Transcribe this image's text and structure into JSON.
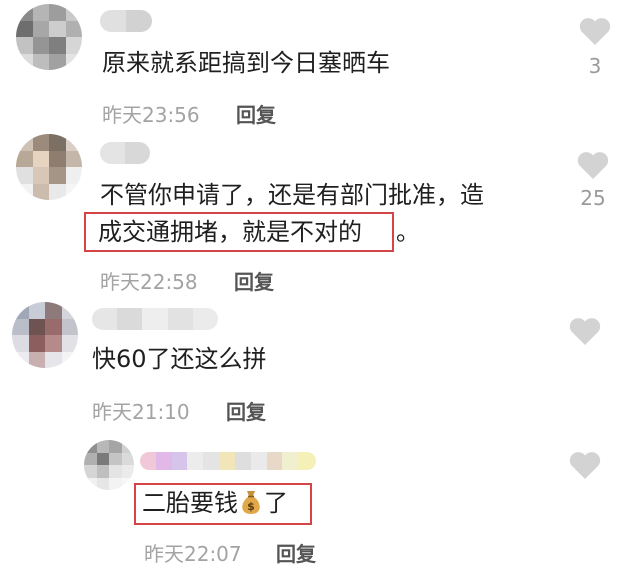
{
  "comments": [
    {
      "text": "原来就系距搞到今日塞晒车",
      "time": "昨天23:56",
      "reply": "回复",
      "likes": "3"
    },
    {
      "text_line1": "不管你申请了，还是有部门批准，造",
      "text_line2_highlight": "成交通拥堵，就是不对的",
      "text_line2_tail": "。",
      "time": "昨天22:58",
      "reply": "回复",
      "likes": "25"
    },
    {
      "text": "快60了还这么拼",
      "time": "昨天21:10",
      "reply": "回复"
    },
    {
      "text_before": "二胎要钱",
      "text_after": "了",
      "time": "昨天22:07",
      "reply": "回复",
      "emoji": "money-bag"
    }
  ],
  "colors": {
    "highlight": "#d64545",
    "heart": "#d3d3d3",
    "meta": "#a3a3a3"
  }
}
